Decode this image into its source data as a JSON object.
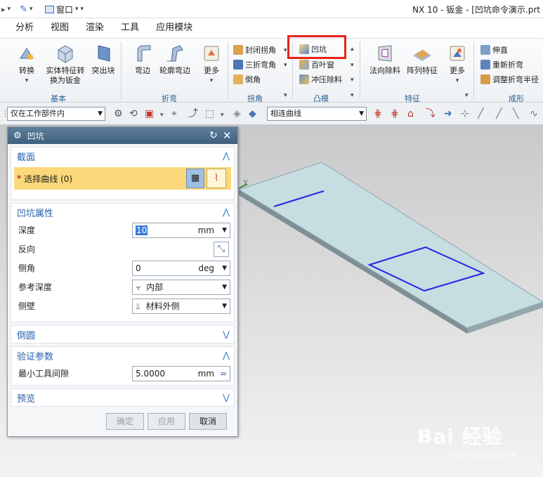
{
  "window": {
    "title": "NX 10 - 钣金 - [凹坑命令演示.prt",
    "quick_menu_label": "窗口"
  },
  "menu_tabs": [
    "分析",
    "视图",
    "渲染",
    "工具",
    "应用模块"
  ],
  "ribbon": {
    "basic": {
      "convert": "转换",
      "solid_to_sheetmetal_1": "实体特征转",
      "solid_to_sheetmetal_2": "换为钣金",
      "tab": "突出块",
      "group": "基本"
    },
    "bend": {
      "flange": "弯边",
      "contour_flange": "轮廓弯边",
      "more": "更多",
      "group": "折弯"
    },
    "corner": {
      "closed_corner": "封闭拐角",
      "three_bend_corner": "三折弯角",
      "chamfer": "倒角",
      "group": "拐角"
    },
    "emboss": {
      "dimple": "凹坑",
      "louver": "百叶窗",
      "drawn_cutout": "冲压除料",
      "group": "凸模"
    },
    "feature": {
      "normal_cutout": "法向除料",
      "pattern_feature": "阵列特征",
      "more": "更多",
      "group": "特征"
    },
    "form": {
      "unbend": "伸直",
      "rebend": "重新折弯",
      "adjust_bend_radius": "调整折弯半径",
      "group": "成形"
    }
  },
  "toolbar": {
    "selection_scope": "仅在工作部件内",
    "curve_rule": "相连曲线"
  },
  "dialog": {
    "title": "凹坑",
    "section": {
      "title": "截面",
      "select_curve": "选择曲线 (0)",
      "required_mark": "*"
    },
    "properties": {
      "title": "凹坑属性",
      "depth_label": "深度",
      "depth_value": "10",
      "depth_unit": "mm",
      "reverse_label": "反向",
      "side_angle_label": "侧角",
      "side_angle_value": "0",
      "side_angle_unit": "deg",
      "ref_depth_label": "参考深度",
      "ref_depth_value": "内部",
      "side_wall_label": "侧壁",
      "side_wall_value": "材料外侧"
    },
    "rounding": {
      "title": "倒圆"
    },
    "validation": {
      "title": "验证参数",
      "min_clearance_label": "最小工具间隙",
      "min_clearance_value": "5.0000",
      "min_clearance_unit": "mm"
    },
    "preview": {
      "title": "预览"
    },
    "buttons": {
      "ok": "确定",
      "apply": "应用",
      "cancel": "取消"
    }
  },
  "viewport": {
    "axis_label": "Y"
  },
  "watermark": {
    "brand": "Bai 经验",
    "url": "jingyan.baidu.com"
  },
  "colors": {
    "accent": "#2360a8",
    "highlight": "#e8221b",
    "selection_row": "#fbd97a",
    "sketch_curve": "#2626e6",
    "sheet_top": "#c6dde2"
  }
}
